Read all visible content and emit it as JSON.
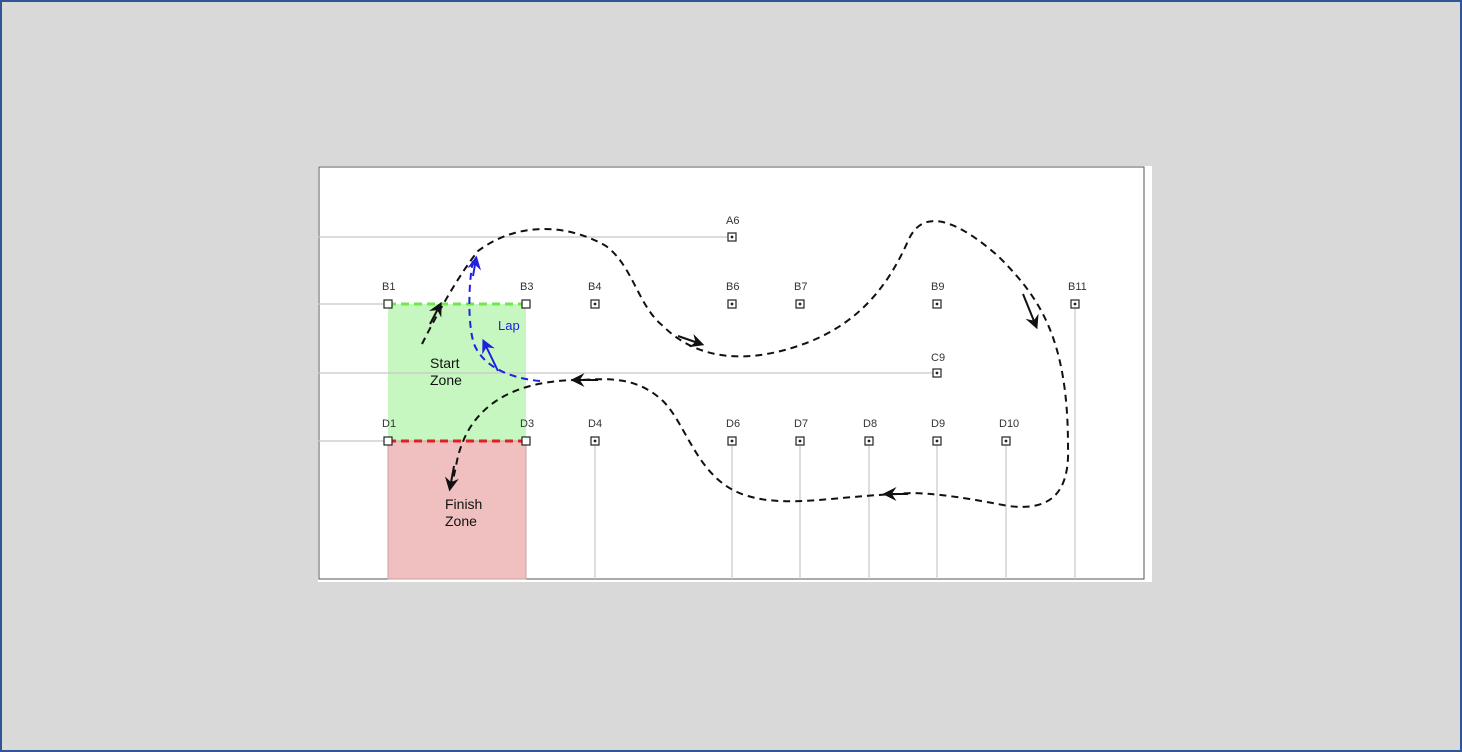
{
  "markers": {
    "A6": "A6",
    "B1": "B1",
    "B3": "B3",
    "B4": "B4",
    "B6": "B6",
    "B7": "B7",
    "B9": "B9",
    "B11": "B11",
    "C9": "C9",
    "D1": "D1",
    "D3": "D3",
    "D4": "D4",
    "D6": "D6",
    "D7": "D7",
    "D8": "D8",
    "D9": "D9",
    "D10": "D10"
  },
  "zones": {
    "start_line1": "Start",
    "start_line2": "Zone",
    "finish_line1": "Finish",
    "finish_line2": "Zone",
    "start_color": "#c6f7c0",
    "finish_color": "#f0c0c0"
  },
  "lap_label": "Lap",
  "colors": {
    "path": "#111111",
    "lap_path": "#2020e0",
    "start_line": "#6ee84a",
    "finish_line": "#e02020",
    "grid": "#c8c8c8"
  }
}
